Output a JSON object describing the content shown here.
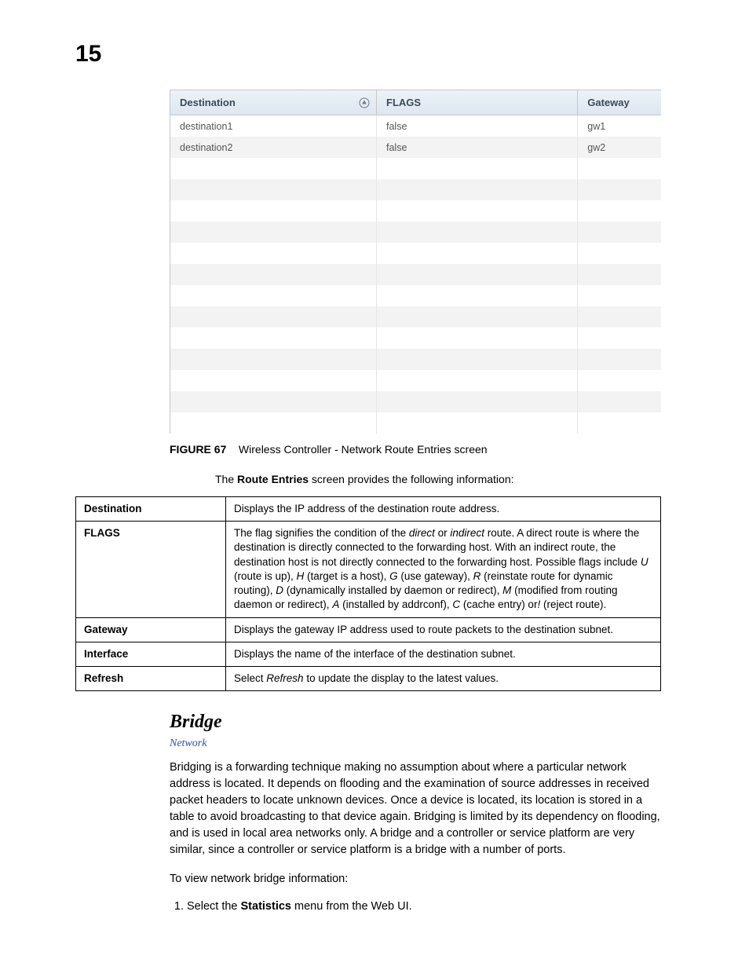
{
  "page_number": "15",
  "screenshot_table": {
    "headers": {
      "destination": "Destination",
      "flags": "FLAGS",
      "gateway": "Gateway"
    },
    "rows": [
      {
        "destination": "destination1",
        "flags": "false",
        "gateway": "gw1"
      },
      {
        "destination": "destination2",
        "flags": "false",
        "gateway": "gw2"
      }
    ],
    "empty_rows": 13
  },
  "figure": {
    "label": "FIGURE 67",
    "title": "Wireless Controller - Network Route Entries screen"
  },
  "intro": {
    "prefix": "The ",
    "bold": "Route Entries",
    "suffix": " screen provides the following information:"
  },
  "definitions": [
    {
      "term": "Destination",
      "desc_html": "Displays the IP address of the destination route address."
    },
    {
      "term": "FLAGS",
      "desc_html": "The flag signifies the condition of the <em class='i'>direct</em> or <em class='i'>indirect</em> route. A direct route is where the destination is directly connected to the forwarding host. With an indirect route, the destination host is not directly connected to the forwarding host. Possible flags include <em class='i'>U</em> (route is up), <em class='i'>H</em> (target is a host), <em class='i'>G</em> (use gateway), <em class='i'>R</em> (reinstate route for dynamic routing), <em class='i'>D</em> (dynamically installed by daemon or redirect), <em class='i'>M</em> (modified from routing daemon or redirect), <em class='i'>A</em> (installed by addrconf), <em class='i'>C</em> (cache entry) or<em class='i'>!</em> (reject route)."
    },
    {
      "term": "Gateway",
      "desc_html": "Displays the gateway IP address used to route packets to the destination subnet."
    },
    {
      "term": "Interface",
      "desc_html": "Displays the name of the interface of the destination subnet."
    },
    {
      "term": "Refresh",
      "desc_html": "Select <em class='i'>Refresh</em> to update the display to the latest values."
    }
  ],
  "section": {
    "title": "Bridge",
    "breadcrumb": "Network",
    "paragraph": "Bridging is a forwarding technique making no assumption about where a particular network address is located. It depends on flooding and the examination of source addresses in received packet headers to locate unknown devices. Once a device is located, its location is stored in a table to avoid broadcasting to that device again. Bridging is limited by its dependency on flooding, and is used in local area networks only. A bridge and a controller or service platform are very similar, since a controller or service platform is a bridge with a number of ports.",
    "lead_in": "To view network bridge information:",
    "step1_prefix": "Select the ",
    "step1_bold": "Statistics",
    "step1_suffix": " menu from the Web UI."
  }
}
